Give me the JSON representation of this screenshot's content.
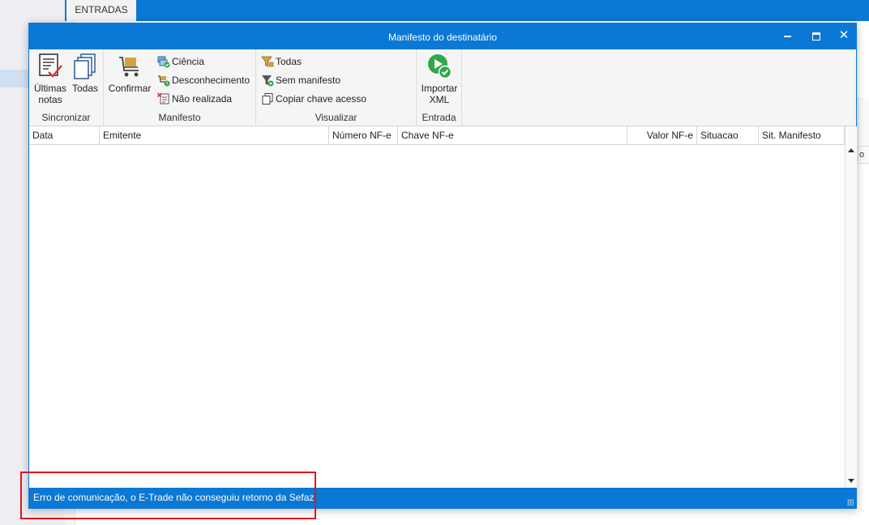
{
  "background": {
    "tab_label": "ENTRADAS",
    "right_cell_text": "o"
  },
  "dialog": {
    "title": "Manifesto do destinatário",
    "window_controls": {
      "minimize": "minimize-icon",
      "maximize": "maximize-icon",
      "close": "close-icon"
    }
  },
  "ribbon": {
    "groups": [
      {
        "label": "Sincronizar",
        "buttons": [
          {
            "label_line1": "Últimas",
            "label_line2": "notas",
            "icon": "checklist-icon"
          },
          {
            "label": "Todas",
            "icon": "stacked-documents-icon"
          }
        ]
      },
      {
        "label": "Manifesto",
        "buttons": [
          {
            "label": "Confirmar",
            "icon": "cart-icon"
          },
          {
            "label": "Ciência",
            "icon": "check-boxes-icon"
          },
          {
            "label": "Desconhecimento",
            "icon": "cart-question-icon"
          },
          {
            "label": "Não realizada",
            "icon": "document-x-icon"
          }
        ]
      },
      {
        "label": "Visualizar",
        "buttons": [
          {
            "label": "Todas",
            "icon": "filter-icon"
          },
          {
            "label": "Sem manifesto",
            "icon": "filter-clear-icon"
          },
          {
            "label": "Copiar chave acesso",
            "icon": "copy-icon"
          }
        ]
      },
      {
        "label": "Entrada",
        "buttons": [
          {
            "label_line1": "Importar",
            "label_line2": "XML",
            "icon": "import-play-icon"
          }
        ]
      }
    ]
  },
  "grid": {
    "columns": [
      "Data",
      "Emitente",
      "Número NF-e",
      "Chave NF-e",
      "Valor NF-e",
      "Situacao",
      "Sit. Manifesto"
    ],
    "rows": []
  },
  "status": {
    "message": "Erro de comunicação, o E-Trade não conseguiu retorno da Sefaz."
  },
  "colors": {
    "accent": "#0a78d4",
    "highlight_box": "#e0141b",
    "ribbon_bg": "#f5f5f5"
  }
}
